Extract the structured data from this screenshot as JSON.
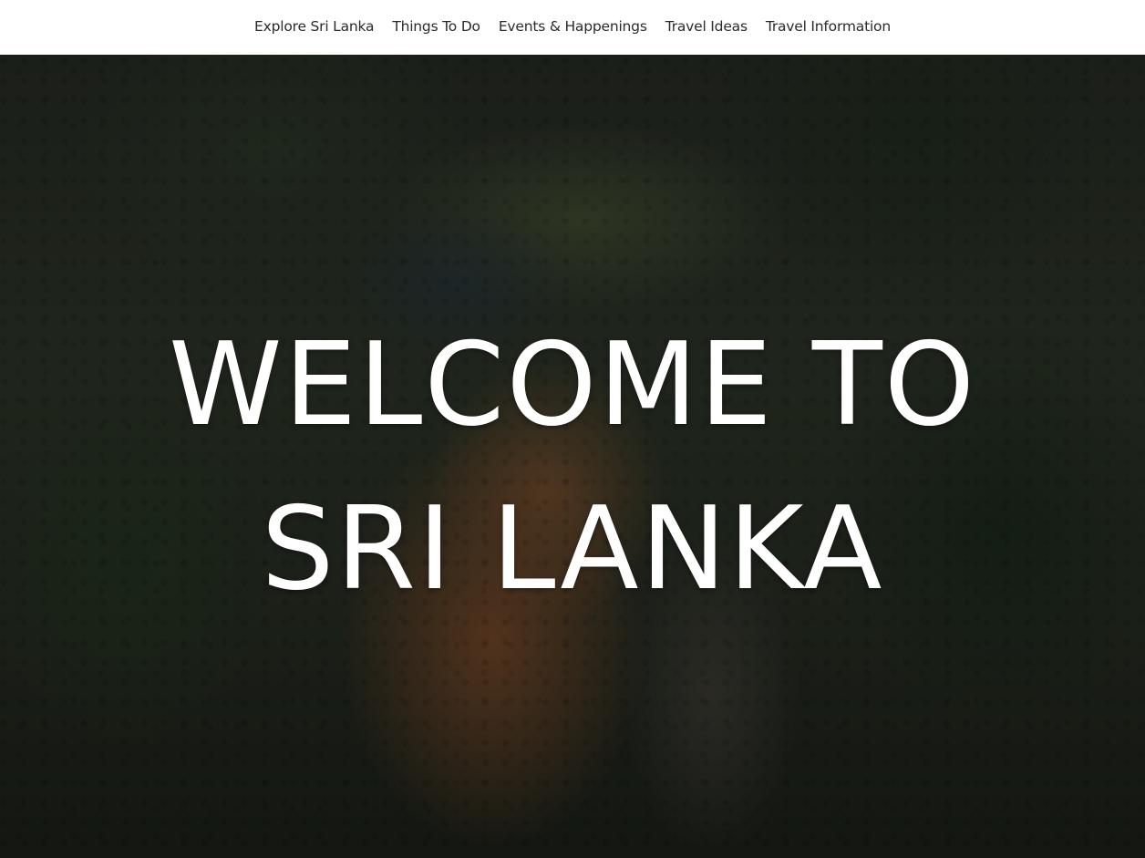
{
  "nav": {
    "items": [
      {
        "label": "Explore Sri Lanka"
      },
      {
        "label": "Things To Do"
      },
      {
        "label": "Events & Happenings"
      },
      {
        "label": "Travel Ideas"
      },
      {
        "label": "Travel Information"
      }
    ]
  },
  "hero": {
    "title_line1": "WELCOME TO",
    "title_line2": "SRI LANKA"
  }
}
